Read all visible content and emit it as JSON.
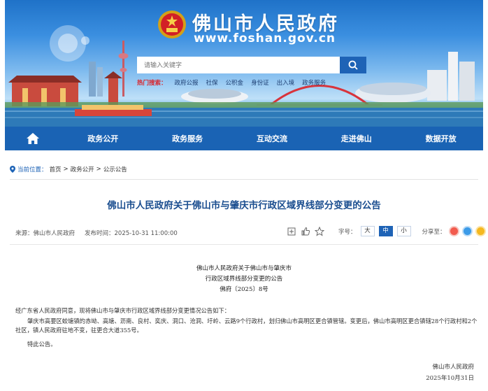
{
  "header": {
    "site_title": "佛山市人民政府",
    "site_url": "www.foshan.gov.cn",
    "search_placeholder": "请输入关键字",
    "hot_label": "热门搜索：",
    "hot_items": [
      "政府公报",
      "社保",
      "公积金",
      "身份证",
      "出入境",
      "政务服务"
    ]
  },
  "nav": {
    "items": [
      "政务公开",
      "政务服务",
      "互动交流",
      "走进佛山",
      "数据开放"
    ]
  },
  "breadcrumb": {
    "label": "当前位置：",
    "items": [
      "首页",
      "政务公开",
      "公示公告"
    ],
    "sep": ">"
  },
  "article": {
    "headline": "佛山市人民政府关于佛山市与肇庆市行政区域界线部分变更的公告",
    "source": "来源：佛山市人民政府",
    "published": "发布时间：2025-10-31 11:00:00",
    "font_label": "字号：",
    "font_sizes": [
      "大",
      "中",
      "小"
    ],
    "share_label": "分享至：",
    "doc_title_1": "佛山市人民政府关于佛山市与肇庆市",
    "doc_title_2": "行政区域界线部分变更的公告",
    "doc_no": "佛府〔2025〕8号",
    "p1": "经广东省人民政府同意，现将佛山市与肇庆市行政区域界线部分变更情况公告如下：",
    "p2": "肇庆市高要区蛟塘镇的赤坳、高塘、沥南、良村、奕庆、洞口、沧洞、圩岭、云路9个行政村，划归佛山市高明区更合镇管辖。变更后，佛山市高明区更合镇辖28个行政村和2个社区，镇人民政府驻地不变，驻更合大道355号。",
    "p3": "特此公告。",
    "signer": "佛山市人民政府",
    "date": "2025年10月31日"
  },
  "colors": {
    "nav": "#1a63b4",
    "headline": "#1a4d8f",
    "accent": "#1e63b6",
    "hot_label": "#d9262d"
  },
  "icons": [
    "national-emblem-icon",
    "search-icon",
    "home-icon",
    "location-pin-icon",
    "print-icon",
    "like-icon",
    "star-icon",
    "weibo-icon",
    "qq-icon",
    "qzone-icon"
  ]
}
